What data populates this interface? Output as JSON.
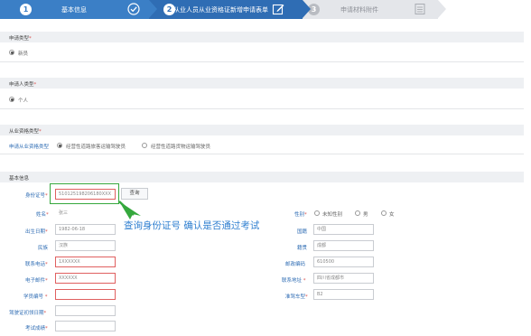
{
  "steps": [
    {
      "num": "1",
      "label": "基本信息"
    },
    {
      "num": "2",
      "label": "从业人员从业资格证新增申请表单"
    },
    {
      "num": "3",
      "label": "申请材料附件"
    }
  ],
  "sections": {
    "apply_type": {
      "title": "申请类型",
      "option": "新员"
    },
    "applicant_type": {
      "title": "申请人类型",
      "option": "个人"
    },
    "qual_type": {
      "title": "从业资格类型",
      "row_label": "申请从业资格类型",
      "options": [
        "经营性道路旅客运输驾驶员",
        "经营性道路货物运输驾驶员"
      ]
    },
    "basic": {
      "title": "基本信息"
    }
  },
  "form": {
    "id_label": "身份证号",
    "id_value": "510125198206180XXX",
    "query_button": "查询",
    "name_label": "姓名",
    "name_value": "张三",
    "gender_label": "性别",
    "gender_options": [
      "未知性别",
      "男",
      "女"
    ],
    "birth_label": "出生日期",
    "birth_value": "1982-06-18",
    "nation_label": "国籍",
    "nation_value": "中国",
    "ethnic_label": "民族",
    "ethnic_value": "汉族",
    "native_label": "籍贯",
    "native_value": "成都",
    "phone_label": "联系电话",
    "phone_value": "1XXXXXX",
    "postcode_label": "邮政编码",
    "postcode_value": "610500",
    "email_label": "电子邮件",
    "email_value": "XXXXXX",
    "address_label": "联系地址",
    "address_value": "四川省成都市",
    "student_label": "学员编号",
    "vehicle_label": "准驾车型",
    "vehicle_value": "B2",
    "license_date_label": "驾驶证初领日期",
    "exam_label": "考试成绩"
  },
  "annotation": "查询身份证号 确认是否通过考试",
  "colors": {
    "step_active": "#3b7fc6",
    "highlight": "#35a83d",
    "annotation": "#2f7fd0",
    "error_border": "#e06060"
  }
}
